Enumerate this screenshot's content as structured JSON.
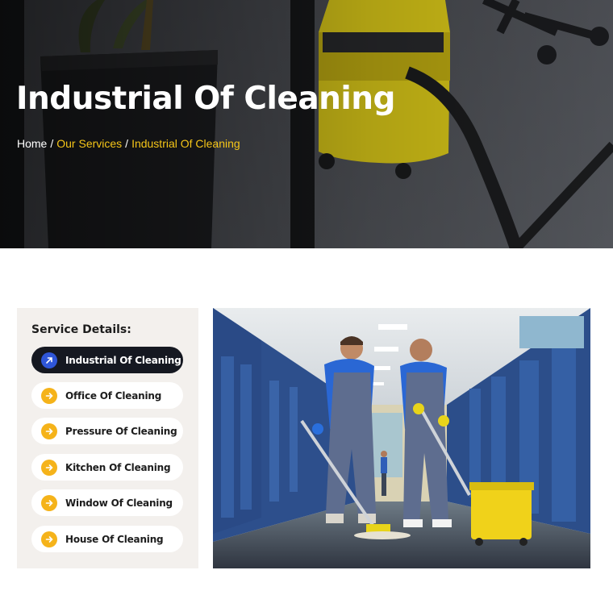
{
  "hero": {
    "title": "Industrial Of Cleaning",
    "breadcrumb": {
      "home": "Home",
      "separator": "/",
      "services": "Our Services",
      "current": "Industrial Of Cleaning"
    }
  },
  "sidebar": {
    "title": "Service Details:",
    "items": [
      {
        "label": "Industrial Of Cleaning",
        "active": true
      },
      {
        "label": "Office Of Cleaning",
        "active": false
      },
      {
        "label": "Pressure Of Cleaning",
        "active": false
      },
      {
        "label": "Kitchen Of Cleaning",
        "active": false
      },
      {
        "label": "Window Of Cleaning",
        "active": false
      },
      {
        "label": "House Of Cleaning",
        "active": false
      }
    ]
  },
  "icons": {
    "active_item_icon": "arrow-up-right-icon",
    "item_icon": "arrow-right-icon"
  },
  "colors": {
    "accent": "#f5c518",
    "active_bg": "#151821",
    "active_icon": "#2f56d8",
    "icon_yellow": "#f5b31a",
    "sidebar_bg": "#f3f0ed"
  }
}
